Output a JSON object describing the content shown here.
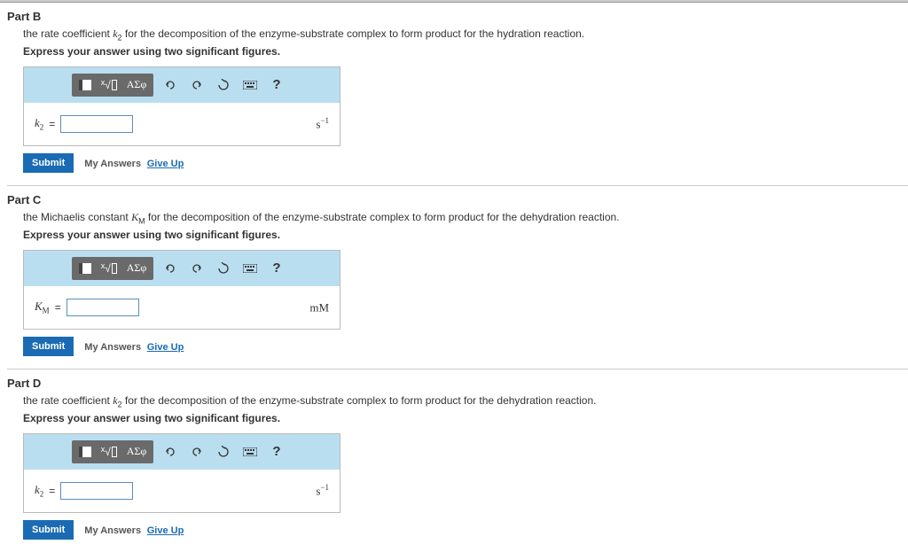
{
  "parts": [
    {
      "header": "Part B",
      "desc_pre": "the rate coefficient ",
      "desc_var": "k",
      "desc_sub": "2",
      "desc_post": " for the decomposition of the enzyme-substrate complex to form product for the hydration reaction.",
      "instruction": "Express your answer using two significant figures.",
      "var": "k",
      "var_sub": "2",
      "eq": "=",
      "unit_base": "s",
      "unit_sup": "−1",
      "unit_plain": ""
    },
    {
      "header": "Part C",
      "desc_pre": "the Michaelis constant ",
      "desc_var": "K",
      "desc_sub": "M",
      "desc_post": " for the decomposition of the enzyme-substrate complex to form product for the dehydration reaction.",
      "instruction": "Express your answer using two significant figures.",
      "var": "K",
      "var_sub": "M",
      "eq": "=",
      "unit_base": "",
      "unit_sup": "",
      "unit_plain": "mM"
    },
    {
      "header": "Part D",
      "desc_pre": "the rate coefficient ",
      "desc_var": "k",
      "desc_sub": "2",
      "desc_post": " for the decomposition of the enzyme-substrate complex to form product for the dehydration reaction.",
      "instruction": "Express your answer using two significant figures.",
      "var": "k",
      "var_sub": "2",
      "eq": "=",
      "unit_base": "s",
      "unit_sup": "−1",
      "unit_plain": ""
    }
  ],
  "toolbar": {
    "template_label": "T",
    "math_label": "√x",
    "greek_label": "ΑΣφ",
    "undo_label": "↶",
    "redo_label": "↷",
    "reset_label": "↻",
    "keyboard_label": "⌨",
    "help_label": "?"
  },
  "actions": {
    "submit": "Submit",
    "my_answers": "My Answers",
    "give_up": "Give Up"
  }
}
